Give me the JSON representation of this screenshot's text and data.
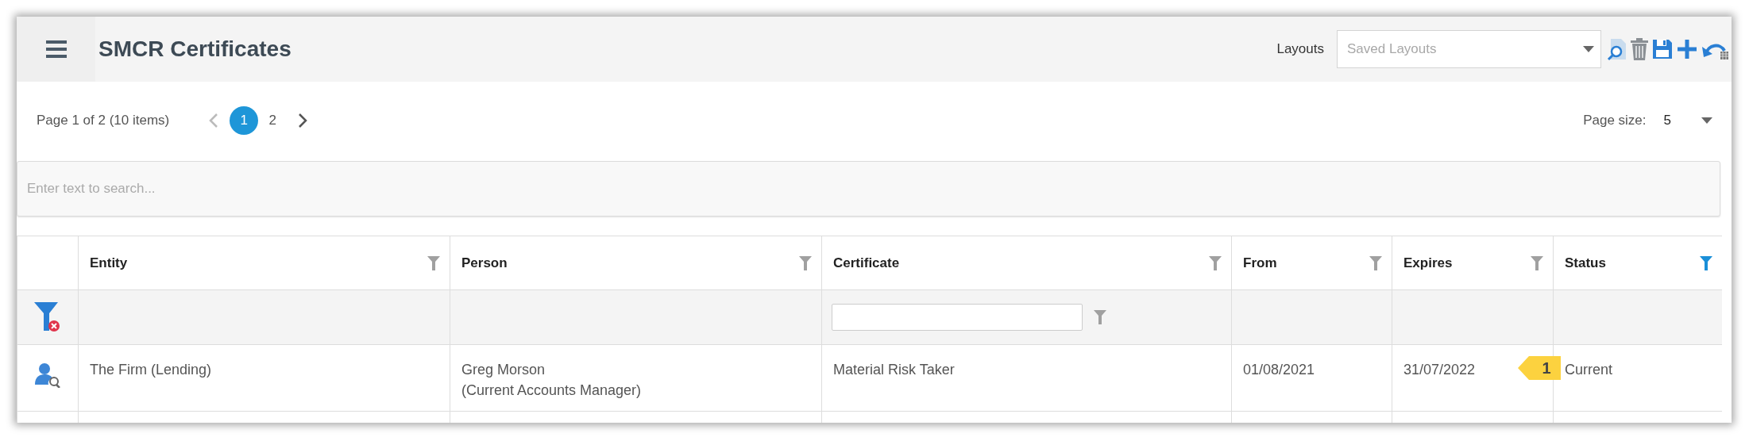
{
  "header": {
    "title": "SMCR Certificates",
    "layouts_label": "Layouts",
    "layouts_select": {
      "placeholder": "Saved Layouts"
    }
  },
  "pager": {
    "summary": "Page 1 of 2 (10 items)",
    "pages": [
      {
        "label": "1",
        "selected": true
      },
      {
        "label": "2",
        "selected": false
      }
    ],
    "page_size_label": "Page size:",
    "page_size": "5"
  },
  "search": {
    "placeholder": "Enter text to search..."
  },
  "table": {
    "columns": [
      {
        "label": "Entity",
        "filter_active": false,
        "filter_field": false
      },
      {
        "label": "Person",
        "filter_active": false,
        "filter_field": false
      },
      {
        "label": "Certificate",
        "filter_active": false,
        "filter_field": true
      },
      {
        "label": "From",
        "filter_active": false,
        "filter_field": false
      },
      {
        "label": "Expires",
        "filter_active": false,
        "filter_field": false
      },
      {
        "label": "Status",
        "filter_active": true,
        "filter_field": false
      }
    ],
    "rows": [
      {
        "cells": [
          {
            "text": "The Firm (Lending)"
          },
          {
            "text": "Greg Morson\n(Current Accounts Manager)"
          },
          {
            "text": "Material Risk Taker"
          },
          {
            "text": "01/08/2021"
          },
          {
            "text": "31/07/2022",
            "marker": "1"
          },
          {
            "text": "Current"
          }
        ]
      }
    ]
  }
}
